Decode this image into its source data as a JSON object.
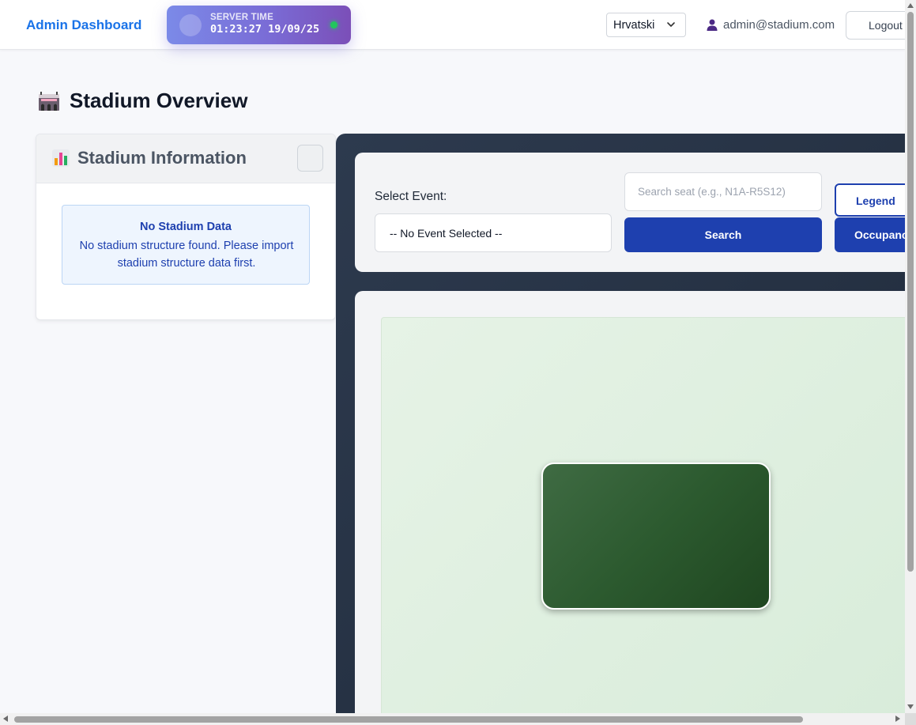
{
  "header": {
    "brand": "Admin Dashboard",
    "server_time": {
      "label": "SERVER TIME",
      "value": "01:23:27 19/09/25"
    },
    "language": {
      "selected": "Hrvatski",
      "icon": "chevron-down-icon"
    },
    "user": {
      "email": "admin@stadium.com",
      "icon": "user-icon"
    },
    "logout_label": "Logout"
  },
  "page": {
    "title": "Stadium Overview",
    "title_icon": "stadium-icon"
  },
  "info_card": {
    "title": "Stadium Information",
    "title_icon": "bar-chart-icon",
    "alert": {
      "title": "No Stadium Data",
      "message": "No stadium structure found. Please import stadium structure data first."
    }
  },
  "controls": {
    "select_event_label": "Select Event:",
    "event_selected": "-- No Event Selected --",
    "search_placeholder": "Search seat (e.g., N1A-R5S12)",
    "search_value": "",
    "search_label": "Search",
    "legend_label": "Legend",
    "occupancy_label": "Occupancy"
  },
  "colors": {
    "brand": "#1a73e8",
    "primary": "#1e40af",
    "panel_dark": "#2d3a4e",
    "pitch": "#2c5a2f",
    "status_online": "#22c55e"
  }
}
